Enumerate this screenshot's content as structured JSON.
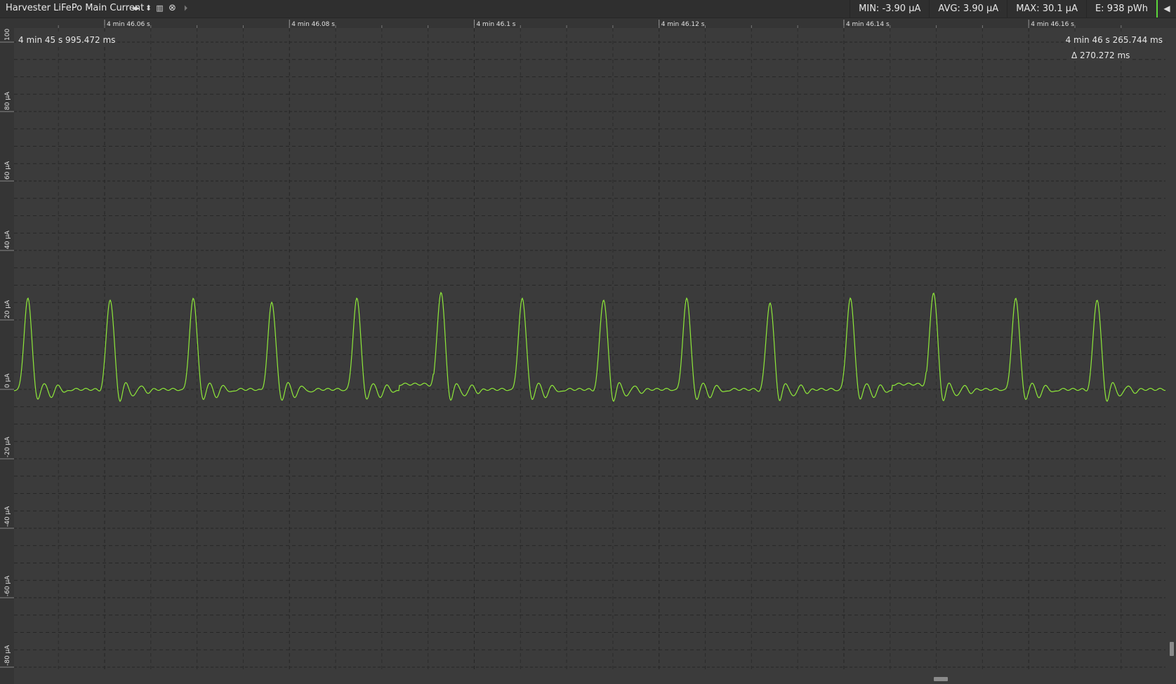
{
  "toolbar": {
    "title": "Harvester LiFePo Main Current",
    "icons": [
      "horizontal-expand-icon",
      "vertical-expand-icon",
      "bar-view-icon",
      "close-icon",
      "play-next-icon"
    ]
  },
  "stats": {
    "min": "MIN: -3.90 µA",
    "avg": "AVG: 3.90 µA",
    "max": "MAX: 30.1 µA",
    "energy": "E: 938 pWh"
  },
  "cursors": {
    "left": "4 min 45 s 995.472 ms",
    "right": "4 min 46 s 265.744 ms",
    "delta": "Δ 270.272 ms"
  },
  "colors": {
    "trace": "#8ee83a",
    "accent": "#5bd63b",
    "grid": "#232323",
    "background": "#3b3b3b"
  },
  "chart_data": {
    "type": "line",
    "x_unit": "s",
    "y_unit": "µA",
    "x_ticks": [
      {
        "value": 286.06,
        "label": "4 min 46.06 s"
      },
      {
        "value": 286.08,
        "label": "4 min 46.08 s"
      },
      {
        "value": 286.1,
        "label": "4 min 46.1 s"
      },
      {
        "value": 286.12,
        "label": "4 min 46.12 s"
      },
      {
        "value": 286.14,
        "label": "4 min 46.14 s"
      },
      {
        "value": 286.16,
        "label": "4 min 46.16 s"
      }
    ],
    "y_ticks": [
      {
        "value": 100,
        "label": "100"
      },
      {
        "value": 80,
        "label": "80 µA"
      },
      {
        "value": 60,
        "label": "60 µA"
      },
      {
        "value": 40,
        "label": "40 µA"
      },
      {
        "value": 20,
        "label": "20 µA"
      },
      {
        "value": 0,
        "label": "0 µA"
      },
      {
        "value": -20,
        "label": "-20 µA"
      },
      {
        "value": -40,
        "label": "-40 µA"
      },
      {
        "value": -60,
        "label": "-60 µA"
      },
      {
        "value": -80,
        "label": "-80 µA"
      }
    ],
    "xlim": [
      286.0502,
      286.1748
    ],
    "ylim": [
      -85,
      100
    ],
    "pulse_peak_times": [
      286.0517,
      286.0606,
      286.0696,
      286.0781,
      286.0873,
      286.0964,
      286.1052,
      286.114,
      286.123,
      286.132,
      286.1407,
      286.1497,
      286.1586,
      286.1674
    ],
    "pulse_peak_values": [
      26,
      26,
      26,
      25,
      26,
      28,
      26,
      26,
      26,
      25,
      26,
      28,
      26,
      26
    ],
    "baseline_values": [
      0,
      0,
      0,
      0,
      0,
      1.5,
      0,
      0,
      0,
      0,
      0,
      1.5,
      0,
      0
    ],
    "series": [
      {
        "values": []
      }
    ]
  }
}
